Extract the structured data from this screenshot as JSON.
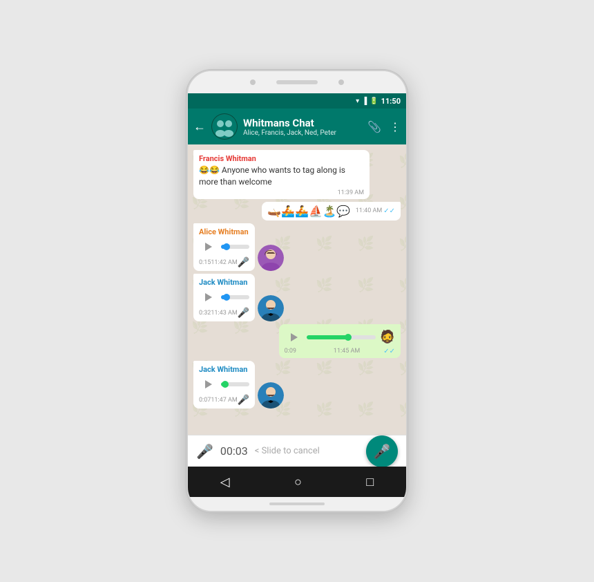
{
  "phone": {
    "statusBar": {
      "time": "11:50"
    },
    "header": {
      "title": "Whitmans Chat",
      "subtitle": "Alice, Francis, Jack, Ned, Peter",
      "backLabel": "←",
      "attachIcon": "📎",
      "menuIcon": "⋮"
    },
    "messages": [
      {
        "id": "msg1",
        "type": "text",
        "sender": "Francis Whitman",
        "senderClass": "sender-francis",
        "text": "😂😂 Anyone who wants to tag along is more than welcome",
        "time": "11:39 AM",
        "direction": "received",
        "hasAvatar": false
      },
      {
        "id": "msg2",
        "type": "emoji",
        "sender": null,
        "emojis": "🛶🚣🚣⛵🏝️💬",
        "time": "11:40 AM",
        "direction": "sent",
        "checks": "✓✓"
      },
      {
        "id": "msg3",
        "type": "audio",
        "sender": "Alice Whitman",
        "senderClass": "sender-alice",
        "duration": "0:15",
        "time": "11:42 AM",
        "direction": "received",
        "avatarType": "alice",
        "progressPct": 20
      },
      {
        "id": "msg4",
        "type": "audio",
        "sender": "Jack Whitman",
        "senderClass": "sender-jack",
        "duration": "0:32",
        "time": "11:43 AM",
        "direction": "received",
        "avatarType": "jack",
        "progressPct": 20
      },
      {
        "id": "msg5",
        "type": "audio-sent",
        "duration": "0:09",
        "time": "11:45 AM",
        "direction": "sent",
        "checks": "✓✓",
        "avatarType": "sent",
        "progressPct": 60
      },
      {
        "id": "msg6",
        "type": "audio",
        "sender": "Jack Whitman",
        "senderClass": "sender-jack",
        "duration": "0:07",
        "time": "11:47 AM",
        "direction": "received",
        "avatarType": "jack",
        "progressPct": 15
      }
    ],
    "recordingBar": {
      "time": "00:03",
      "cancelText": "< Slide to cancel"
    },
    "navbar": {
      "back": "◁",
      "home": "○",
      "square": "□"
    }
  },
  "colors": {
    "teal": "#00796b",
    "tealDark": "#00695c",
    "green": "#25d366",
    "blue": "#2196f3",
    "receivedBg": "#ffffff",
    "sentBg": "#dcf8c6"
  }
}
